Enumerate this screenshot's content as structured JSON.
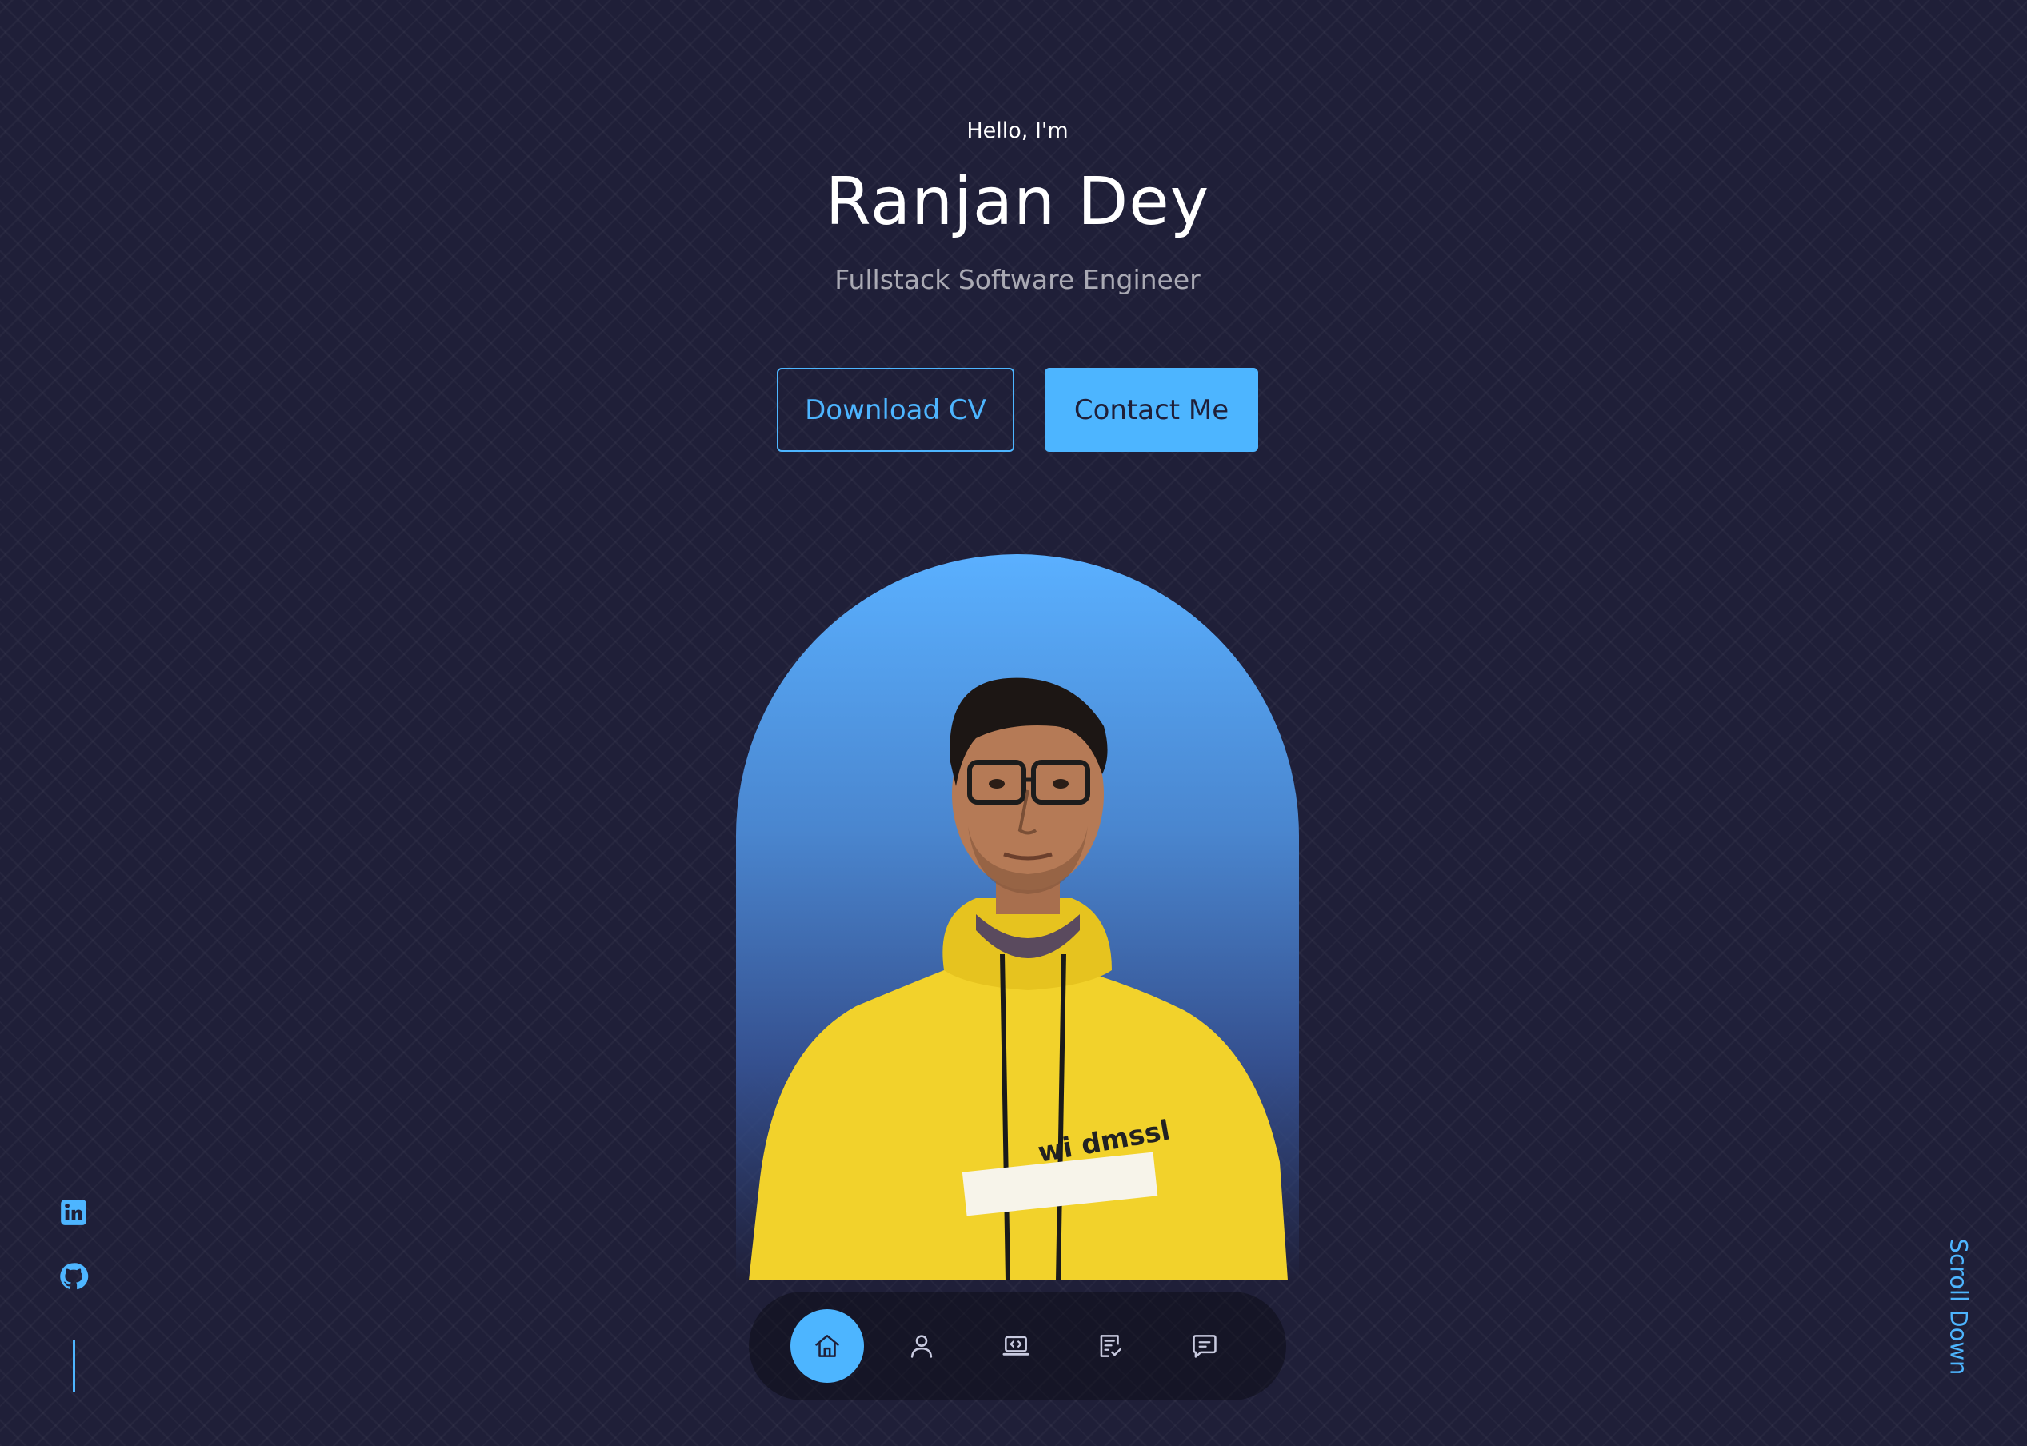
{
  "header": {
    "greeting": "Hello, I'm",
    "name": "Ranjan Dey",
    "role": "Fullstack Software Engineer"
  },
  "actions": {
    "download_cv": "Download CV",
    "contact_me": "Contact Me"
  },
  "social": {
    "links": [
      {
        "icon": "linkedin-icon"
      },
      {
        "icon": "github-icon"
      }
    ]
  },
  "scroll": {
    "label": "Scroll Down"
  },
  "nav": {
    "items": [
      {
        "icon": "home-icon",
        "active": true
      },
      {
        "icon": "user-icon",
        "active": false
      },
      {
        "icon": "laptop-code-icon",
        "active": false
      },
      {
        "icon": "checklist-icon",
        "active": false
      },
      {
        "icon": "message-icon",
        "active": false
      }
    ]
  },
  "colors": {
    "background": "#1f1f38",
    "accent": "#4db5ff",
    "text": "#ffffff"
  }
}
